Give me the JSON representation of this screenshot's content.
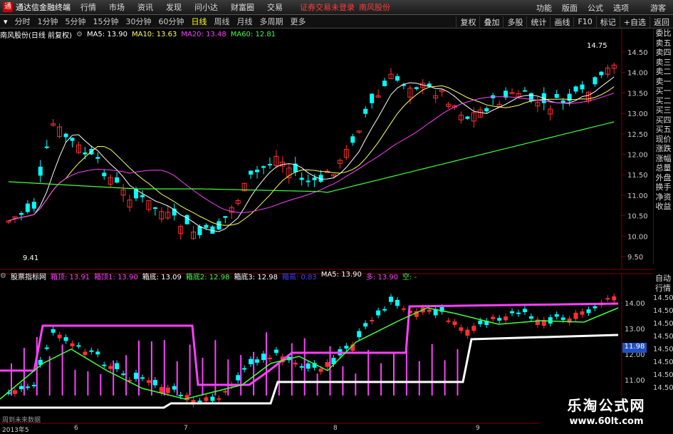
{
  "menubar": {
    "app_title": "通达信金融终端",
    "items": [
      "行情",
      "市场",
      "资讯",
      "发现",
      "问小达",
      "财富圈",
      "交易"
    ],
    "notice": "证券交易未登录",
    "stock": "南风股份",
    "right_items": [
      "功能",
      "版面",
      "公式",
      "选项"
    ],
    "guest": "游客"
  },
  "toolbar": {
    "periods": [
      "分时",
      "1分钟",
      "5分钟",
      "15分钟",
      "30分钟",
      "60分钟",
      "日线",
      "周线",
      "月线",
      "多周期",
      "更多"
    ],
    "active": "日线",
    "right_items": [
      "复权",
      "叠加",
      "多股",
      "统计",
      "画线",
      "F10",
      "标记",
      "+自选",
      "返回"
    ]
  },
  "main_panel": {
    "title": "南风股份(日线 前复权)",
    "ma5": "MA5: 13.90",
    "ma10": "MA10: 13.63",
    "ma20": "MA20: 13.48",
    "ma60": "MA60: 12.81",
    "high_label": "14.75",
    "low_label": "9.41",
    "price_ticks": [
      "14.50",
      "14.00",
      "13.50",
      "13.00",
      "12.50",
      "12.00",
      "11.50",
      "11.00",
      "10.50",
      "10.00",
      "9.50"
    ]
  },
  "sub_panel": {
    "title": "股票指标网",
    "items": [
      {
        "text": "箱顶: 13.91",
        "color": "#ff40ff"
      },
      {
        "text": "箱顶1: 13.90",
        "color": "#ff40ff"
      },
      {
        "text": "箱底: 13.09",
        "color": "#ffffff"
      },
      {
        "text": "箱底2: 12.98",
        "color": "#40ff40"
      },
      {
        "text": "箱底3: 12.98",
        "color": "#ffffff"
      },
      {
        "text": "箱高: 0.83",
        "color": "#4040ff"
      },
      {
        "text": "MA5: 13.90",
        "color": "#ffffff"
      },
      {
        "text": "多: 13.90",
        "color": "#ff40ff"
      },
      {
        "text": "空: -",
        "color": "#40ff40"
      }
    ],
    "price_ticks": [
      "14.00",
      "13.00",
      "12.00",
      "11.00"
    ],
    "right_ticks": [
      "14.50",
      "14.50",
      "14.50",
      "14.50",
      "14.50",
      "14.50",
      "14.50",
      "14.50"
    ],
    "current": "11.98"
  },
  "right_panel": [
    "委比",
    "卖五",
    "卖四",
    "卖三",
    "卖二",
    "卖一",
    "买一",
    "买二",
    "买三",
    "买四",
    "买五",
    "现价",
    "涨跌",
    "涨幅",
    "总量",
    "外盘",
    "换手",
    "净资",
    "收益"
  ],
  "right_panel2": [
    "自动",
    "行情"
  ],
  "hint": "周到未来数据",
  "dates": [
    "2013年5",
    "6",
    "7",
    "8",
    "9"
  ],
  "watermark": {
    "line1": "乐淘公式网",
    "line2": "www.60lt.com"
  },
  "colors": {
    "up": "#ff3030",
    "down": "#00ffff",
    "ma5": "#ffffff",
    "ma10": "#ffff60",
    "ma20": "#ff40ff",
    "ma60": "#40ff40"
  }
}
